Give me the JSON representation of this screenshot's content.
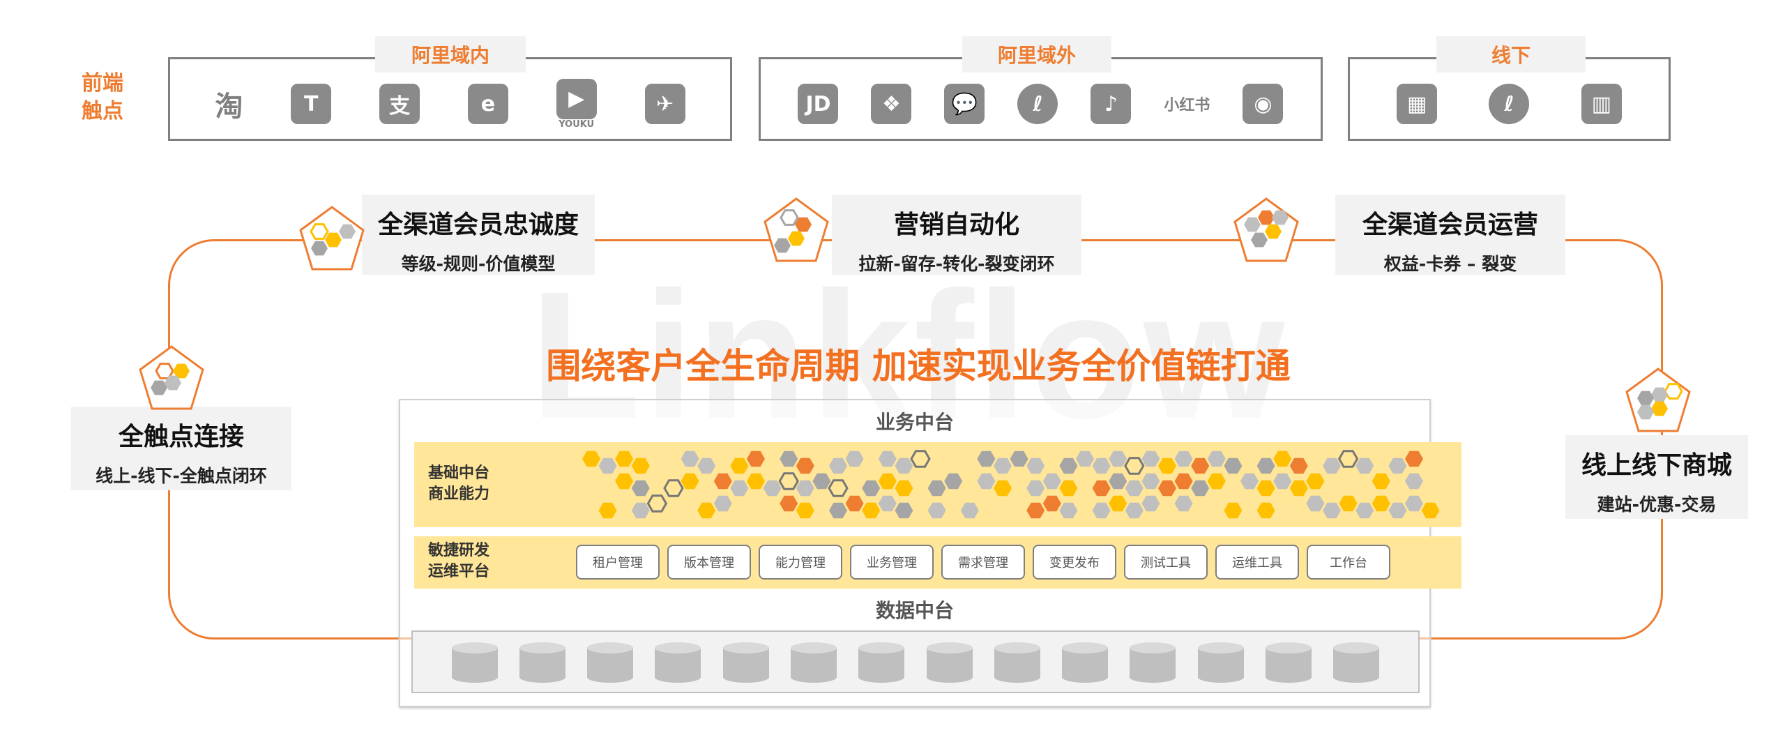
{
  "front_label": [
    "前端",
    "触点"
  ],
  "channels": [
    {
      "title": "阿里域内",
      "icons": [
        {
          "name": "taobao-icon",
          "glyph": "淘"
        },
        {
          "name": "tmall-icon",
          "glyph": "T"
        },
        {
          "name": "alipay-icon",
          "glyph": "支"
        },
        {
          "name": "eleme-icon",
          "glyph": "e"
        },
        {
          "name": "youku-icon",
          "glyph": "▶",
          "caption": "YOUKU"
        },
        {
          "name": "dingtalk-icon",
          "glyph": "✈"
        }
      ]
    },
    {
      "title": "阿里域外",
      "icons": [
        {
          "name": "jd-icon",
          "glyph": "JD"
        },
        {
          "name": "pinduoduo-icon",
          "glyph": "❖"
        },
        {
          "name": "wechat-icon",
          "glyph": "💬"
        },
        {
          "name": "mini-program-icon",
          "glyph": "ℓ"
        },
        {
          "name": "douyin-icon",
          "glyph": "♪"
        },
        {
          "name": "xiaohongshu-icon",
          "glyph": "小红书"
        },
        {
          "name": "weibo-icon",
          "glyph": "◉"
        }
      ]
    },
    {
      "title": "线下",
      "icons": [
        {
          "name": "qr-guide-icon",
          "glyph": "▦"
        },
        {
          "name": "mini-program-icon",
          "glyph": "ℓ"
        },
        {
          "name": "store-icon",
          "glyph": "▥"
        }
      ]
    }
  ],
  "cards": [
    {
      "title": "全渠道会员忠诚度",
      "sub": "等级-规则-价值模型"
    },
    {
      "title": "营销自动化",
      "sub": "拉新-留存-转化-裂变闭环"
    },
    {
      "title": "全渠道会员运营",
      "sub": "权益-卡券 – 裂变"
    },
    {
      "title": "全触点连接",
      "sub": "线上-线下-全触点闭环"
    },
    {
      "title": "线上线下商城",
      "sub": "建站-优惠-交易"
    }
  ],
  "watermark": "Linkflow",
  "headline": "围绕客户全生命周期  加速实现业务全价值链打通",
  "platform": {
    "business_title": "业务中台",
    "base_label": [
      "基础中台",
      "商业能力"
    ],
    "devops_label": [
      "敏捷研发",
      "运维平台"
    ],
    "tools": [
      "租户管理",
      "版本管理",
      "能力管理",
      "业务管理",
      "需求管理",
      "变更发布",
      "测试工具",
      "运维工具",
      "工作台"
    ],
    "data_title": "数据中台",
    "db_count": 14
  },
  "colors": {
    "orange": "#ee7d31",
    "yellow": "#ffc000",
    "gray": "#a5a5a5",
    "light": "#bfbfbf",
    "band": "#ffe699"
  }
}
